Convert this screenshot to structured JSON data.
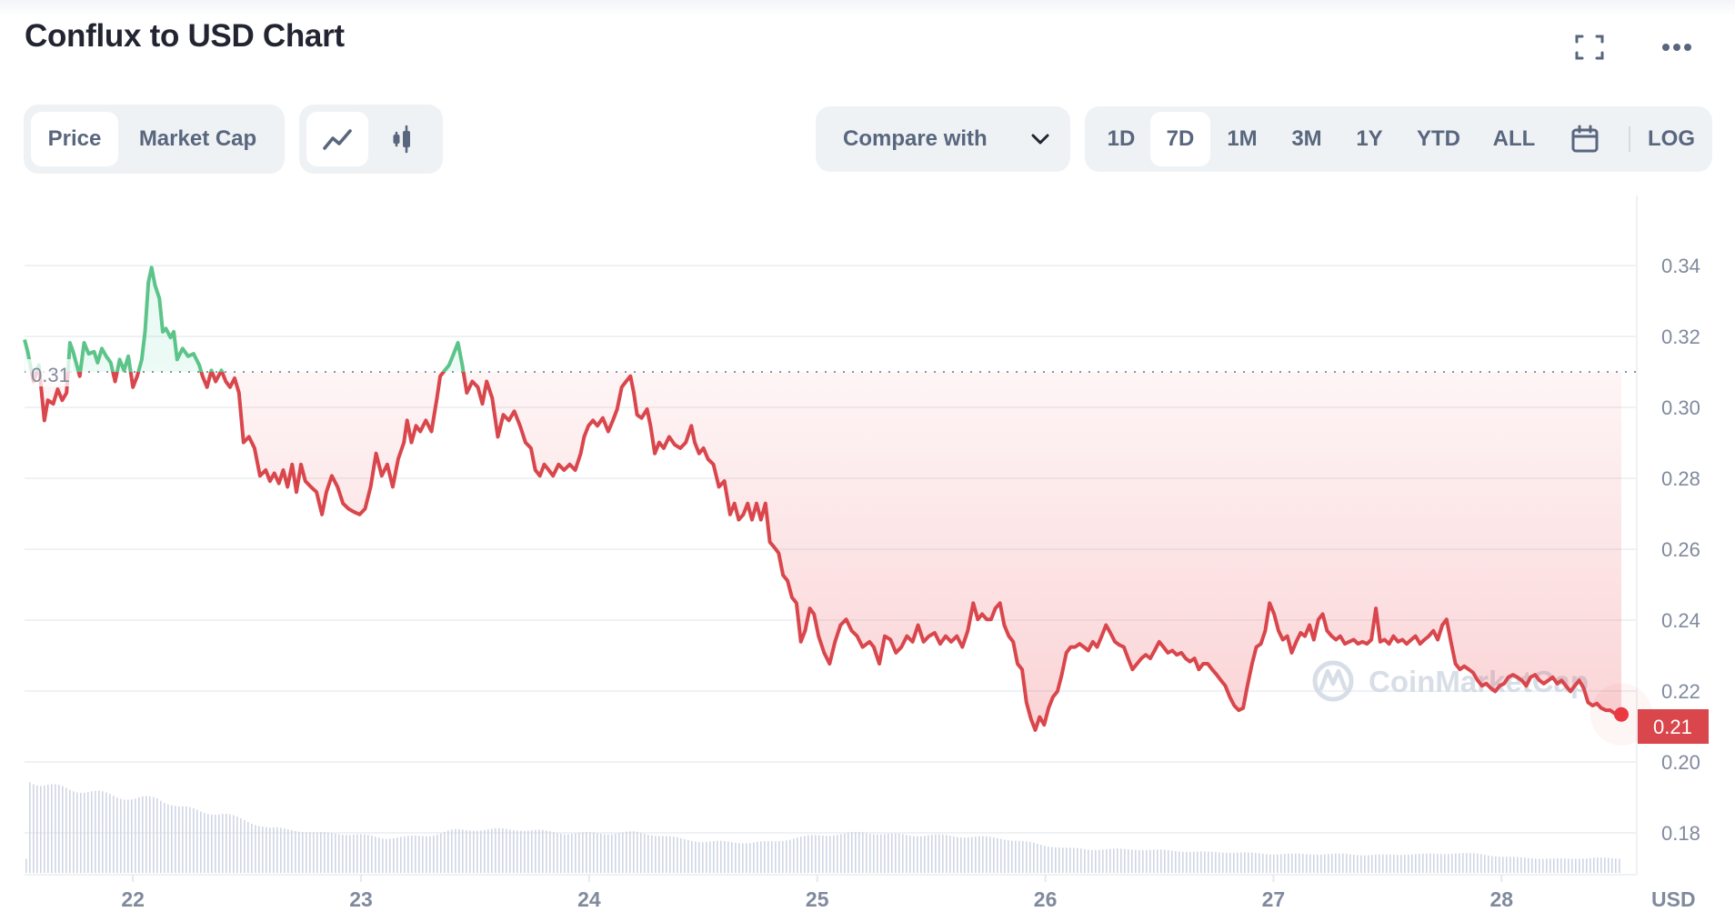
{
  "header": {
    "title": "Conflux to USD Chart",
    "fullscreen_icon": "fullscreen-icon",
    "more_icon": "more-horizontal-icon"
  },
  "toolbar": {
    "data_tabs": [
      {
        "label": "Price",
        "active": true
      },
      {
        "label": "Market Cap",
        "active": false
      }
    ],
    "chart_types": [
      {
        "icon": "line-chart-icon",
        "active": true
      },
      {
        "icon": "candlestick-icon",
        "active": false
      }
    ],
    "compare_label": "Compare with",
    "compare_icon": "chevron-down-icon",
    "ranges": [
      {
        "label": "1D",
        "active": false
      },
      {
        "label": "7D",
        "active": true
      },
      {
        "label": "1M",
        "active": false
      },
      {
        "label": "3M",
        "active": false
      },
      {
        "label": "1Y",
        "active": false
      },
      {
        "label": "YTD",
        "active": false
      },
      {
        "label": "ALL",
        "active": false
      }
    ],
    "calendar_icon": "calendar-icon",
    "log_label": "LOG"
  },
  "colors": {
    "up": "#16c784",
    "down": "#ea3943",
    "line_up": "#5cc489",
    "line_down": "#d9464c",
    "axis_text": "#808a9d",
    "grid": "#eff2f5",
    "volume": "#cfd6e4"
  },
  "watermark": "CoinMarketCap",
  "chart_data": {
    "type": "line",
    "title": "Conflux to USD Chart",
    "xlabel": "",
    "ylabel": "USD",
    "currency_label": "USD",
    "baseline": 0.31,
    "baseline_label": "0.31",
    "current_price": 0.21,
    "current_price_label": "0.21",
    "ylim": [
      0.17,
      0.355
    ],
    "yticks": [
      0.18,
      0.2,
      0.22,
      0.24,
      0.26,
      0.28,
      0.3,
      0.32,
      0.34
    ],
    "ytick_labels": [
      "0.18",
      "0.20",
      "0.22",
      "0.24",
      "0.26",
      "0.28",
      "0.30",
      "0.32",
      "0.34"
    ],
    "xlim": [
      21.525,
      28.525
    ],
    "xticks": [
      22,
      23,
      24,
      25,
      26,
      27,
      28
    ],
    "xtick_labels": [
      "22",
      "23",
      "24",
      "25",
      "26",
      "27",
      "28"
    ],
    "grid": true,
    "series": [
      {
        "name": "Price",
        "t": [
          21.525,
          21.539,
          21.564,
          21.588,
          21.612,
          21.627,
          21.651,
          21.67,
          21.69,
          21.709,
          21.724,
          21.738,
          21.767,
          21.786,
          21.806,
          21.83,
          21.845,
          21.864,
          21.883,
          21.903,
          21.922,
          21.942,
          21.961,
          21.98,
          22.0,
          22.019,
          22.039,
          22.053,
          22.068,
          22.082,
          22.097,
          22.116,
          22.131,
          22.145,
          22.165,
          22.179,
          22.194,
          22.218,
          22.242,
          22.266,
          22.291,
          22.305,
          22.325,
          22.344,
          22.363,
          22.388,
          22.407,
          22.426,
          22.446,
          22.465,
          22.485,
          22.509,
          22.533,
          22.557,
          22.582,
          22.601,
          22.62,
          22.64,
          22.659,
          22.678,
          22.698,
          22.717,
          22.737,
          22.756,
          22.78,
          22.805,
          22.829,
          22.848,
          22.872,
          22.897,
          22.921,
          22.945,
          22.969,
          22.994,
          23.018,
          23.042,
          23.066,
          23.091,
          23.115,
          23.139,
          23.163,
          23.188,
          23.202,
          23.221,
          23.241,
          23.26,
          23.284,
          23.309,
          23.333,
          23.347,
          23.367,
          23.386,
          23.406,
          23.425,
          23.444,
          23.464,
          23.488,
          23.512,
          23.532,
          23.551,
          23.575,
          23.6,
          23.624,
          23.648,
          23.672,
          23.697,
          23.721,
          23.745,
          23.764,
          23.784,
          23.803,
          23.823,
          23.842,
          23.866,
          23.89,
          23.915,
          23.939,
          23.963,
          23.978,
          23.997,
          24.017,
          24.036,
          24.06,
          24.084,
          24.104,
          24.123,
          24.143,
          24.162,
          24.181,
          24.196,
          24.21,
          24.23,
          24.254,
          24.269,
          24.288,
          24.307,
          24.327,
          24.351,
          24.375,
          24.4,
          24.424,
          24.448,
          24.463,
          24.482,
          24.501,
          24.521,
          24.545,
          24.569,
          24.593,
          24.618,
          24.637,
          24.656,
          24.676,
          24.695,
          24.714,
          24.734,
          24.753,
          24.773,
          24.792,
          24.812,
          24.831,
          24.85,
          24.87,
          24.889,
          24.909,
          24.928,
          24.947,
          24.967,
          24.986,
          25.006,
          25.03,
          25.054,
          25.078,
          25.102,
          25.127,
          25.151,
          25.175,
          25.199,
          25.229,
          25.248,
          25.272,
          25.296,
          25.321,
          25.345,
          25.369,
          25.393,
          25.418,
          25.442,
          25.466,
          25.49,
          25.515,
          25.539,
          25.563,
          25.587,
          25.612,
          25.636,
          25.66,
          25.684,
          25.704,
          25.723,
          25.743,
          25.762,
          25.781,
          25.801,
          25.82,
          25.84,
          25.859,
          25.878,
          25.898,
          25.917,
          25.937,
          25.956,
          25.975,
          25.995,
          26.014,
          26.033,
          26.053,
          26.072,
          26.092,
          26.111,
          26.13,
          26.15,
          26.169,
          26.188,
          26.208,
          26.227,
          26.247,
          26.266,
          26.285,
          26.305,
          26.324,
          26.344,
          26.363,
          26.382,
          26.402,
          26.421,
          26.44,
          26.46,
          26.479,
          26.499,
          26.518,
          26.537,
          26.557,
          26.576,
          26.596,
          26.615,
          26.634,
          26.654,
          26.673,
          26.692,
          26.712,
          26.731,
          26.751,
          26.77,
          26.789,
          26.809,
          26.828,
          26.848,
          26.867,
          26.886,
          26.906,
          26.925,
          26.945,
          26.964,
          26.983,
          27.003,
          27.022,
          27.041,
          27.061,
          27.08,
          27.1,
          27.119,
          27.138,
          27.158,
          27.177,
          27.197,
          27.216,
          27.235,
          27.255,
          27.274,
          27.293,
          27.313,
          27.332,
          27.352,
          27.371,
          27.39,
          27.41,
          27.429,
          27.449,
          27.468,
          27.487,
          27.507,
          27.526,
          27.546,
          27.565,
          27.584,
          27.604,
          27.623,
          27.643,
          27.662,
          27.681,
          27.701,
          27.72,
          27.74,
          27.759,
          27.778,
          27.798,
          27.817,
          27.836,
          27.856,
          27.875,
          27.895,
          27.914,
          27.933,
          27.953,
          27.972,
          27.992,
          28.011,
          28.03,
          28.05,
          28.069,
          28.089,
          28.108,
          28.127,
          28.147,
          28.166,
          28.185,
          28.205,
          28.224,
          28.244,
          28.263,
          28.282,
          28.302,
          28.321,
          28.341,
          28.36,
          28.379,
          28.399,
          28.418,
          28.437,
          28.457,
          28.476,
          28.496,
          28.525
        ],
        "p": [
          0.3191,
          0.3157,
          0.3073,
          0.3119,
          0.2963,
          0.302,
          0.301,
          0.3051,
          0.302,
          0.3041,
          0.3182,
          0.3157,
          0.3088,
          0.3182,
          0.3151,
          0.3157,
          0.3126,
          0.3166,
          0.3144,
          0.3126,
          0.3073,
          0.3135,
          0.3104,
          0.3144,
          0.3057,
          0.3088,
          0.3135,
          0.3213,
          0.3353,
          0.3394,
          0.3344,
          0.3307,
          0.3213,
          0.3222,
          0.3197,
          0.3213,
          0.3135,
          0.3166,
          0.3144,
          0.3151,
          0.3119,
          0.3088,
          0.3057,
          0.3104,
          0.3073,
          0.3104,
          0.3073,
          0.3057,
          0.3082,
          0.3041,
          0.2901,
          0.2917,
          0.2885,
          0.2807,
          0.2823,
          0.2792,
          0.2814,
          0.2786,
          0.2823,
          0.2776,
          0.2839,
          0.2761,
          0.2839,
          0.2792,
          0.2776,
          0.2761,
          0.2698,
          0.2761,
          0.2807,
          0.2776,
          0.2729,
          0.2714,
          0.2705,
          0.2698,
          0.2714,
          0.2776,
          0.287,
          0.2807,
          0.2839,
          0.2776,
          0.2854,
          0.2901,
          0.2963,
          0.2901,
          0.2948,
          0.2932,
          0.2963,
          0.2932,
          0.3026,
          0.3088,
          0.3104,
          0.3119,
          0.3151,
          0.3182,
          0.3119,
          0.3041,
          0.3073,
          0.3057,
          0.301,
          0.3073,
          0.3026,
          0.2917,
          0.2979,
          0.2963,
          0.2989,
          0.2948,
          0.2901,
          0.2885,
          0.2823,
          0.2807,
          0.2839,
          0.2823,
          0.2807,
          0.2839,
          0.2823,
          0.2839,
          0.2823,
          0.287,
          0.2917,
          0.2948,
          0.2963,
          0.2948,
          0.297,
          0.2932,
          0.2963,
          0.2995,
          0.3057,
          0.3073,
          0.3088,
          0.3041,
          0.2979,
          0.297,
          0.2995,
          0.2948,
          0.287,
          0.2901,
          0.2885,
          0.2917,
          0.2895,
          0.2885,
          0.2901,
          0.2948,
          0.2901,
          0.287,
          0.2885,
          0.2854,
          0.2839,
          0.2776,
          0.2792,
          0.2698,
          0.2729,
          0.2683,
          0.2698,
          0.2729,
          0.2683,
          0.2729,
          0.2683,
          0.2729,
          0.262,
          0.2605,
          0.2589,
          0.2527,
          0.2511,
          0.2464,
          0.2448,
          0.2339,
          0.237,
          0.2433,
          0.2417,
          0.2355,
          0.2308,
          0.2277,
          0.2339,
          0.2386,
          0.2402,
          0.237,
          0.2355,
          0.2324,
          0.2339,
          0.2324,
          0.2277,
          0.2355,
          0.2345,
          0.2308,
          0.2324,
          0.2355,
          0.2339,
          0.2386,
          0.2339,
          0.2355,
          0.2364,
          0.2333,
          0.2355,
          0.2339,
          0.2355,
          0.2324,
          0.237,
          0.2448,
          0.2402,
          0.2417,
          0.2402,
          0.2402,
          0.2433,
          0.2448,
          0.2386,
          0.2355,
          0.2339,
          0.2277,
          0.2261,
          0.2168,
          0.2121,
          0.209,
          0.2127,
          0.2105,
          0.2152,
          0.2183,
          0.2199,
          0.2246,
          0.2308,
          0.2324,
          0.2324,
          0.2333,
          0.2324,
          0.2314,
          0.2339,
          0.2324,
          0.2355,
          0.2386,
          0.2364,
          0.2339,
          0.233,
          0.2324,
          0.2292,
          0.2261,
          0.2277,
          0.2292,
          0.2302,
          0.2292,
          0.2314,
          0.2339,
          0.2324,
          0.2308,
          0.2314,
          0.2302,
          0.2308,
          0.2292,
          0.2283,
          0.2292,
          0.2261,
          0.2277,
          0.2277,
          0.2261,
          0.2246,
          0.223,
          0.2215,
          0.2183,
          0.2159,
          0.2146,
          0.2152,
          0.2215,
          0.2277,
          0.2324,
          0.2333,
          0.237,
          0.2448,
          0.2417,
          0.237,
          0.2345,
          0.2355,
          0.2308,
          0.2339,
          0.2364,
          0.2355,
          0.2386,
          0.2345,
          0.2402,
          0.2417,
          0.237,
          0.2355,
          0.2345,
          0.2355,
          0.2333,
          0.2339,
          0.2345,
          0.2333,
          0.2339,
          0.2333,
          0.2345,
          0.2433,
          0.2339,
          0.2345,
          0.2333,
          0.2355,
          0.2339,
          0.2345,
          0.2333,
          0.2345,
          0.2355,
          0.2333,
          0.2345,
          0.2355,
          0.237,
          0.2345,
          0.2386,
          0.2402,
          0.2339,
          0.2277,
          0.2261,
          0.227,
          0.2261,
          0.2252,
          0.223,
          0.2215,
          0.2221,
          0.2208,
          0.2199,
          0.2215,
          0.2221,
          0.2239,
          0.2246,
          0.2239,
          0.223,
          0.2215,
          0.2239,
          0.2246,
          0.223,
          0.2221,
          0.223,
          0.2239,
          0.2221,
          0.223,
          0.2215,
          0.2199,
          0.2215,
          0.223,
          0.2208,
          0.2168,
          0.2159,
          0.2165,
          0.2152,
          0.2146,
          0.2146,
          0.2137,
          0.2134
        ]
      }
    ],
    "volume": {
      "name": "Volume",
      "relative_levels": [
        [
          21.53,
          1.0
        ],
        [
          21.6,
          0.93
        ],
        [
          21.7,
          0.9
        ],
        [
          21.8,
          0.86
        ],
        [
          21.9,
          0.83
        ],
        [
          22.0,
          0.78
        ],
        [
          22.1,
          0.8
        ],
        [
          22.2,
          0.7
        ],
        [
          22.3,
          0.65
        ],
        [
          22.4,
          0.62
        ],
        [
          22.5,
          0.55
        ],
        [
          22.6,
          0.47
        ],
        [
          22.7,
          0.46
        ],
        [
          22.8,
          0.42
        ],
        [
          22.9,
          0.42
        ],
        [
          23.0,
          0.4
        ],
        [
          23.1,
          0.37
        ],
        [
          23.2,
          0.38
        ],
        [
          23.3,
          0.4
        ],
        [
          23.4,
          0.45
        ],
        [
          23.5,
          0.46
        ],
        [
          23.6,
          0.46
        ],
        [
          23.7,
          0.46
        ],
        [
          23.8,
          0.44
        ],
        [
          23.9,
          0.42
        ],
        [
          24.0,
          0.42
        ],
        [
          24.1,
          0.42
        ],
        [
          24.2,
          0.43
        ],
        [
          24.3,
          0.4
        ],
        [
          24.4,
          0.36
        ],
        [
          24.5,
          0.33
        ],
        [
          24.6,
          0.33
        ],
        [
          24.7,
          0.32
        ],
        [
          24.8,
          0.33
        ],
        [
          24.9,
          0.37
        ],
        [
          25.0,
          0.4
        ],
        [
          25.1,
          0.41
        ],
        [
          25.2,
          0.43
        ],
        [
          25.3,
          0.41
        ],
        [
          25.4,
          0.4
        ],
        [
          25.5,
          0.4
        ],
        [
          25.6,
          0.39
        ],
        [
          25.7,
          0.38
        ],
        [
          25.8,
          0.37
        ],
        [
          25.9,
          0.33
        ],
        [
          26.0,
          0.29
        ],
        [
          26.1,
          0.26
        ],
        [
          26.2,
          0.25
        ],
        [
          26.3,
          0.25
        ],
        [
          26.4,
          0.25
        ],
        [
          26.5,
          0.24
        ],
        [
          26.6,
          0.23
        ],
        [
          26.7,
          0.22
        ],
        [
          26.8,
          0.22
        ],
        [
          26.9,
          0.21
        ],
        [
          27.0,
          0.2
        ],
        [
          27.1,
          0.2
        ],
        [
          27.2,
          0.2
        ],
        [
          27.3,
          0.2
        ],
        [
          27.4,
          0.19
        ],
        [
          27.5,
          0.19
        ],
        [
          27.6,
          0.2
        ],
        [
          27.7,
          0.2
        ],
        [
          27.8,
          0.21
        ],
        [
          27.9,
          0.2
        ],
        [
          28.0,
          0.17
        ],
        [
          28.1,
          0.16
        ],
        [
          28.2,
          0.15
        ],
        [
          28.3,
          0.15
        ],
        [
          28.4,
          0.16
        ],
        [
          28.525,
          0.15
        ]
      ]
    }
  }
}
